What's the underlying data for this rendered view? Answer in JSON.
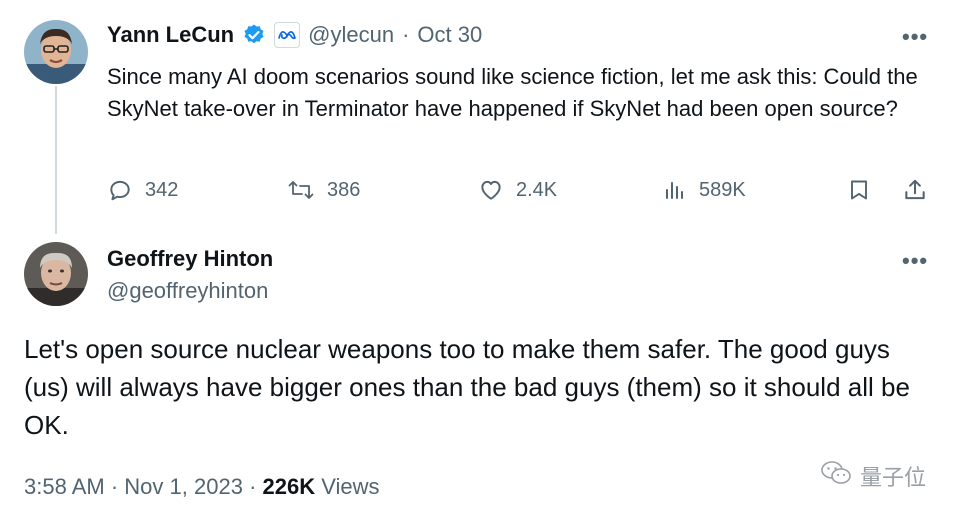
{
  "original_tweet": {
    "display_name": "Yann LeCun",
    "handle": "@ylecun",
    "separator": "·",
    "date": "Oct 30",
    "text": "Since many AI doom scenarios sound like science fiction, let me ask this: Could the SkyNet take-over in Terminator have happened if SkyNet had been open source?",
    "replies": "342",
    "reposts": "386",
    "likes": "2.4K",
    "views": "589K",
    "verified_color": "#1d9bf0",
    "affiliation_badge": "meta-icon"
  },
  "reply_tweet": {
    "display_name": "Geoffrey Hinton",
    "handle": "@geoffreyhinton",
    "text": "Let's open source nuclear weapons too to make them safer. The good guys (us) will always have bigger ones than the bad guys (them) so it should all be OK.",
    "time": "3:58 AM",
    "separator": "·",
    "date": "Nov 1, 2023",
    "views_count": "226K",
    "views_label": "Views"
  },
  "more_label": "•••",
  "watermark": {
    "text": "量子位"
  }
}
